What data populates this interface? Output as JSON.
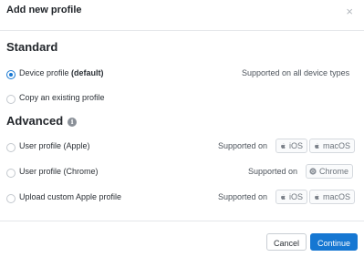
{
  "dialog": {
    "title": "Add new profile",
    "close_symbol": "×"
  },
  "standard": {
    "title": "Standard",
    "options": [
      {
        "label": "Device profile",
        "label_bold": "(default)",
        "checked": true,
        "supported_text": "Supported on all device types"
      },
      {
        "label": "Copy an existing profile",
        "checked": false
      }
    ]
  },
  "advanced": {
    "title": "Advanced",
    "info_icon": "info-icon",
    "options": [
      {
        "label": "User profile (Apple)",
        "supported_text": "Supported on",
        "badges": [
          "iOS",
          "macOS"
        ]
      },
      {
        "label": "User profile (Chrome)",
        "supported_text": "Supported on",
        "badges": [
          "Chrome"
        ]
      },
      {
        "label": "Upload custom Apple profile",
        "supported_text": "Supported on",
        "badges": [
          "iOS",
          "macOS"
        ]
      }
    ]
  },
  "footer": {
    "cancel_label": "Cancel",
    "continue_label": "Continue"
  },
  "colors": {
    "accent": "#1677d2",
    "text": "#22262b",
    "muted": "#6d747c",
    "divider": "#e5e7ea"
  }
}
